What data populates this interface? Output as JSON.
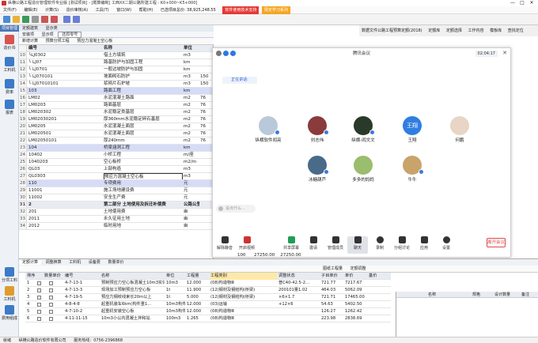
{
  "window": {
    "title": "纵横公路工程造价管理软件专业版 [测试项目] - [概算编制] 工西XX二期公路所建工程 - K0+000~K5+000]",
    "controls": [
      "—",
      "□",
      "✕"
    ]
  },
  "menu": {
    "items": [
      "文件(F)",
      "编辑(E)",
      "计算(S)",
      "造价审核(A)",
      "工具(T)",
      "窗口(W)",
      "帮助(H)"
    ],
    "status_text": "已选项目总价: 38,925,248.55",
    "badge1": "软件使用技术支持",
    "badge2": "限定学习系列"
  },
  "left_panel": {
    "tab": "项目管理",
    "items": [
      {
        "label": "造价书"
      },
      {
        "label": "工料机"
      },
      {
        "label": "费率"
      },
      {
        "label": "报表"
      },
      {
        "label": "分项工料"
      },
      {
        "label": "工料机"
      },
      {
        "label": "费用组成"
      }
    ]
  },
  "grid": {
    "tabs": [
      "定额建筑",
      "显示类"
    ],
    "subtabs": [
      "安装项",
      "显示项",
      "还原零号"
    ],
    "tools": [
      "新增计算",
      "预算分项工程",
      "预应力混凝土空心板"
    ],
    "headers": [
      "",
      "编号",
      "名称",
      "单位",
      ""
    ],
    "rows": [
      {
        "n": "10",
        "code": "└LJ0302",
        "name": "借土方填筑",
        "unit": "m3",
        "qty": "",
        "style": ""
      },
      {
        "n": "11",
        "code": "└ LJ07",
        "name": "路基防护与加固工程",
        "unit": "km",
        "qty": "",
        "style": ""
      },
      {
        "n": "12",
        "code": "└ LJ0701",
        "name": "一般边坡防护与加固",
        "unit": "km",
        "qty": "",
        "style": ""
      },
      {
        "n": "13",
        "code": "└ LJ070101",
        "name": "坡面砌石防护",
        "unit": "m3",
        "qty": "150",
        "style": ""
      },
      {
        "n": "14",
        "code": "└ LJ07010101",
        "name": "浆砌片石护坡",
        "unit": "m3",
        "qty": "150",
        "style": ""
      },
      {
        "n": "15",
        "code": "103",
        "name": "路面工程",
        "unit": "km",
        "qty": "",
        "style": "blue"
      },
      {
        "n": "16",
        "code": "LM02",
        "name": "水泥混凝土路面",
        "unit": "m2",
        "qty": "76",
        "style": ""
      },
      {
        "n": "17",
        "code": "LM0203",
        "name": "路面基层",
        "unit": "m2",
        "qty": "76",
        "style": ""
      },
      {
        "n": "18",
        "code": "LM020302",
        "name": "水泥稳定类基层",
        "unit": "m2",
        "qty": "76",
        "style": ""
      },
      {
        "n": "19",
        "code": "LM02030201",
        "name": "厚360mm水泥稳定碎石基层",
        "unit": "m2",
        "qty": "76",
        "style": ""
      },
      {
        "n": "20",
        "code": "LM0205",
        "name": "水泥混凝土面层",
        "unit": "m2",
        "qty": "76",
        "style": ""
      },
      {
        "n": "21",
        "code": "LM020501",
        "name": "水泥混凝土面层",
        "unit": "m2",
        "qty": "76",
        "style": ""
      },
      {
        "n": "22",
        "code": "LM02050101",
        "name": "厚240mm",
        "unit": "m2",
        "qty": "76",
        "style": ""
      },
      {
        "n": "23",
        "code": "104",
        "name": "桥梁涵洞工程",
        "unit": "km",
        "qty": "",
        "style": "blue"
      },
      {
        "n": "24",
        "code": "10402",
        "name": "小桥工程",
        "unit": "m/座",
        "qty": "",
        "style": ""
      },
      {
        "n": "25",
        "code": "1040203",
        "name": "空心板桥",
        "unit": "m2/m",
        "qty": "",
        "style": ""
      },
      {
        "n": "26",
        "code": "QL03",
        "name": "上部构造",
        "unit": "m3",
        "qty": "",
        "style": ""
      },
      {
        "n": "27",
        "code": "QL0303",
        "name": "预应力混凝土空心板",
        "unit": "m3",
        "qty": "",
        "style": "sel"
      },
      {
        "n": "28",
        "code": "110",
        "name": "专项费用",
        "unit": "元",
        "qty": "",
        "style": "blue"
      },
      {
        "n": "29",
        "code": "11001",
        "name": "施工场地建设费",
        "unit": "元",
        "qty": "",
        "style": ""
      },
      {
        "n": "30",
        "code": "11002",
        "name": "安全生产费",
        "unit": "元",
        "qty": "",
        "style": ""
      },
      {
        "n": "31",
        "code": "2",
        "name": "第二部分 土地使用及拆迁补偿费",
        "unit": "公路公里",
        "qty": "",
        "style": "hdr"
      },
      {
        "n": "32",
        "code": "201",
        "name": "土地使用费",
        "unit": "亩",
        "qty": "",
        "style": ""
      },
      {
        "n": "33",
        "code": "2011",
        "name": "永久征用土地",
        "unit": "亩",
        "qty": "",
        "style": ""
      },
      {
        "n": "34",
        "code": "2012",
        "name": "临时用地",
        "unit": "亩",
        "qty": "",
        "style": ""
      }
    ]
  },
  "right_top": {
    "tabs": [
      "数据文件公路工程预算定额(2018)",
      "定额库",
      "定额选择",
      "工作内容",
      "模板库",
      "查找定位"
    ]
  },
  "meeting": {
    "title": "腾讯会议",
    "time": "02:04:17",
    "speaking": "正在讲话:",
    "participants": [
      {
        "name": "纵横软件阎亮",
        "text": ""
      },
      {
        "name": "刘志伟",
        "text": ""
      },
      {
        "name": "纵横-阎文文",
        "text": ""
      },
      {
        "name": "王翔",
        "text": "王翔"
      },
      {
        "name": "何鹏",
        "text": ""
      },
      {
        "name": "冰糖葫芦",
        "text": ""
      },
      {
        "name": "多多的妈妈",
        "text": ""
      },
      {
        "name": "牛牛",
        "text": ""
      }
    ],
    "input_placeholder": "说点什么...",
    "toolbar": [
      "解除静音",
      "开启视频",
      "共享屏幕",
      "邀请",
      "管理成员",
      "聊天",
      "录制",
      "分组讨论",
      "应用",
      "设置"
    ],
    "leave": "离开会议"
  },
  "bottom": {
    "tabs": [
      "定额计算",
      "调整换算",
      "工料机",
      "设备费",
      "数量单价"
    ],
    "tools": [
      "图纸工程量",
      "定额调整"
    ],
    "headers": [
      "排序",
      "",
      "数量单价",
      "编号",
      "名称",
      "单位",
      "工程量",
      "工程类别",
      "调整状态",
      "子目单价",
      "单价",
      "基价"
    ],
    "rows": [
      {
        "n": "1",
        "code": "4-7-13-1",
        "name": "预制预应力空心板混凝土10m3实体",
        "unit": "10m3",
        "qty": "12.000",
        "cat": "(08)构造物Ⅲ",
        "adj": "普C40-42.5-2…",
        "p1": "721.77",
        "p2": "7217.67",
        "p3": ""
      },
      {
        "n": "2",
        "code": "4-7-13-3",
        "name": "现场加工预制预应力空心板",
        "unit": "1t",
        "qty": "11.900",
        "cat": "(12)钢材及钢结构(桥梁)",
        "adj": "200101量1.02",
        "p1": "464.03",
        "p2": "5062.09",
        "p3": ""
      },
      {
        "n": "3",
        "code": "4-7-19-5",
        "name": "预应力钢绞线束长20m以上",
        "unit": "1t",
        "qty": "5.000",
        "cat": "(12)钢材及钢结构(桥梁)",
        "adj": "×6×1.7",
        "p1": "721.71",
        "p2": "17465.00",
        "p3": ""
      },
      {
        "n": "4",
        "code": "4-8-4-8",
        "name": "起重机装车6km(构件重1…",
        "unit": "10m3构件",
        "qty": "12.000",
        "cat": "(03)运输",
        "adj": "+12×6",
        "p1": "54.63",
        "p2": "5402.50",
        "p3": ""
      },
      {
        "n": "5",
        "code": "4-7-10-2",
        "name": "起重机安装空心板",
        "unit": "10m3构件",
        "qty": "12.000",
        "cat": "(08)构造物Ⅲ",
        "adj": "",
        "p1": "126.27",
        "p2": "1262.42",
        "p3": ""
      },
      {
        "n": "6",
        "code": "4-11-11-15",
        "name": "10m3小以内混凝土拌和站",
        "unit": "100m3",
        "qty": "1.265",
        "cat": "(08)构造物Ⅲ",
        "adj": "",
        "p1": "223.98",
        "p2": "2838.69",
        "p3": ""
      }
    ],
    "partial_values": [
      "100",
      "27250.00",
      "27250.00"
    ]
  },
  "right_mini": {
    "headers": [
      "名称",
      "规格",
      "设计数量",
      "备注"
    ]
  },
  "status": {
    "items": [
      "就绪",
      "纵横公路造价软件有限公司",
      "服务热线：0756-2396868"
    ]
  }
}
